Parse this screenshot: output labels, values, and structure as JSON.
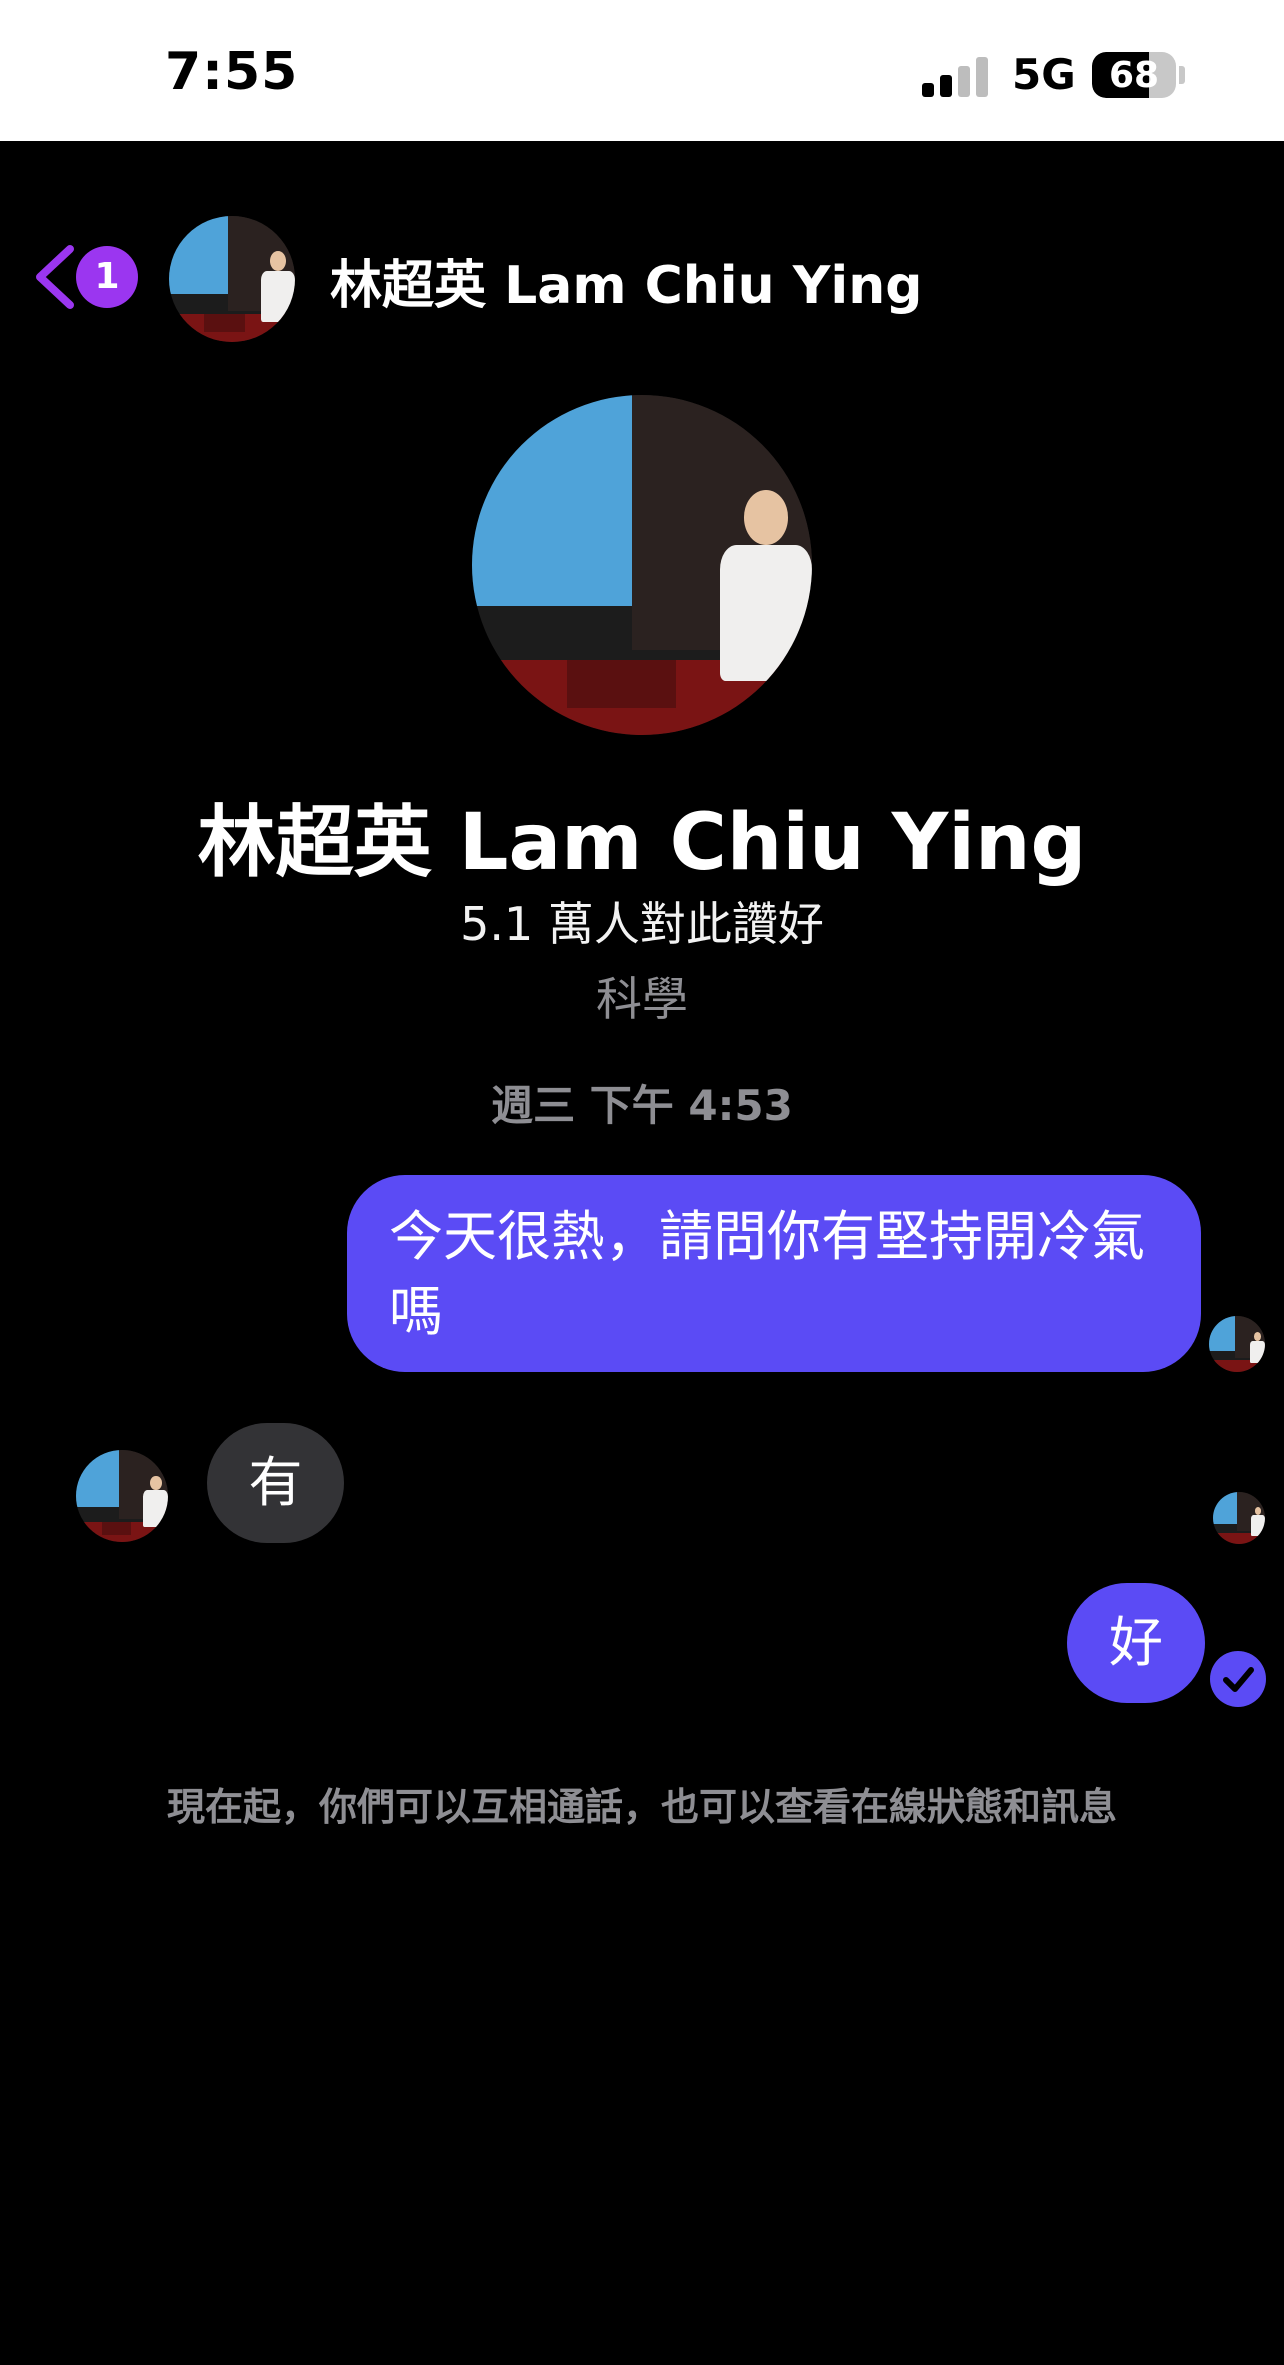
{
  "status_bar": {
    "time": "7:55",
    "network": "5G",
    "battery": "68",
    "battery_level": 0.68
  },
  "header": {
    "back_badge_count": "1",
    "name": "林超英 Lam Chiu Ying",
    "icons": {
      "back": "chevron-left-icon"
    }
  },
  "profile": {
    "name": "林超英 Lam Chiu Ying",
    "likes": "5.1 萬人對此讚好",
    "category": "科學"
  },
  "conversation": {
    "timestamp": "週三 下午 4:53",
    "messages": [
      {
        "direction": "outgoing",
        "text": "今天很熱，請問你有堅持開冷氣嗎"
      },
      {
        "direction": "incoming",
        "text": "有"
      },
      {
        "direction": "outgoing",
        "text": "好"
      }
    ],
    "system_note": "現在起，你們可以互相通話，也可以查看在線狀態和訊息"
  },
  "colors": {
    "accent": "#9b36f0",
    "outgoing_bubble": "#5b4bf5",
    "incoming_bubble": "#333336",
    "muted_text": "#8e8e93"
  }
}
